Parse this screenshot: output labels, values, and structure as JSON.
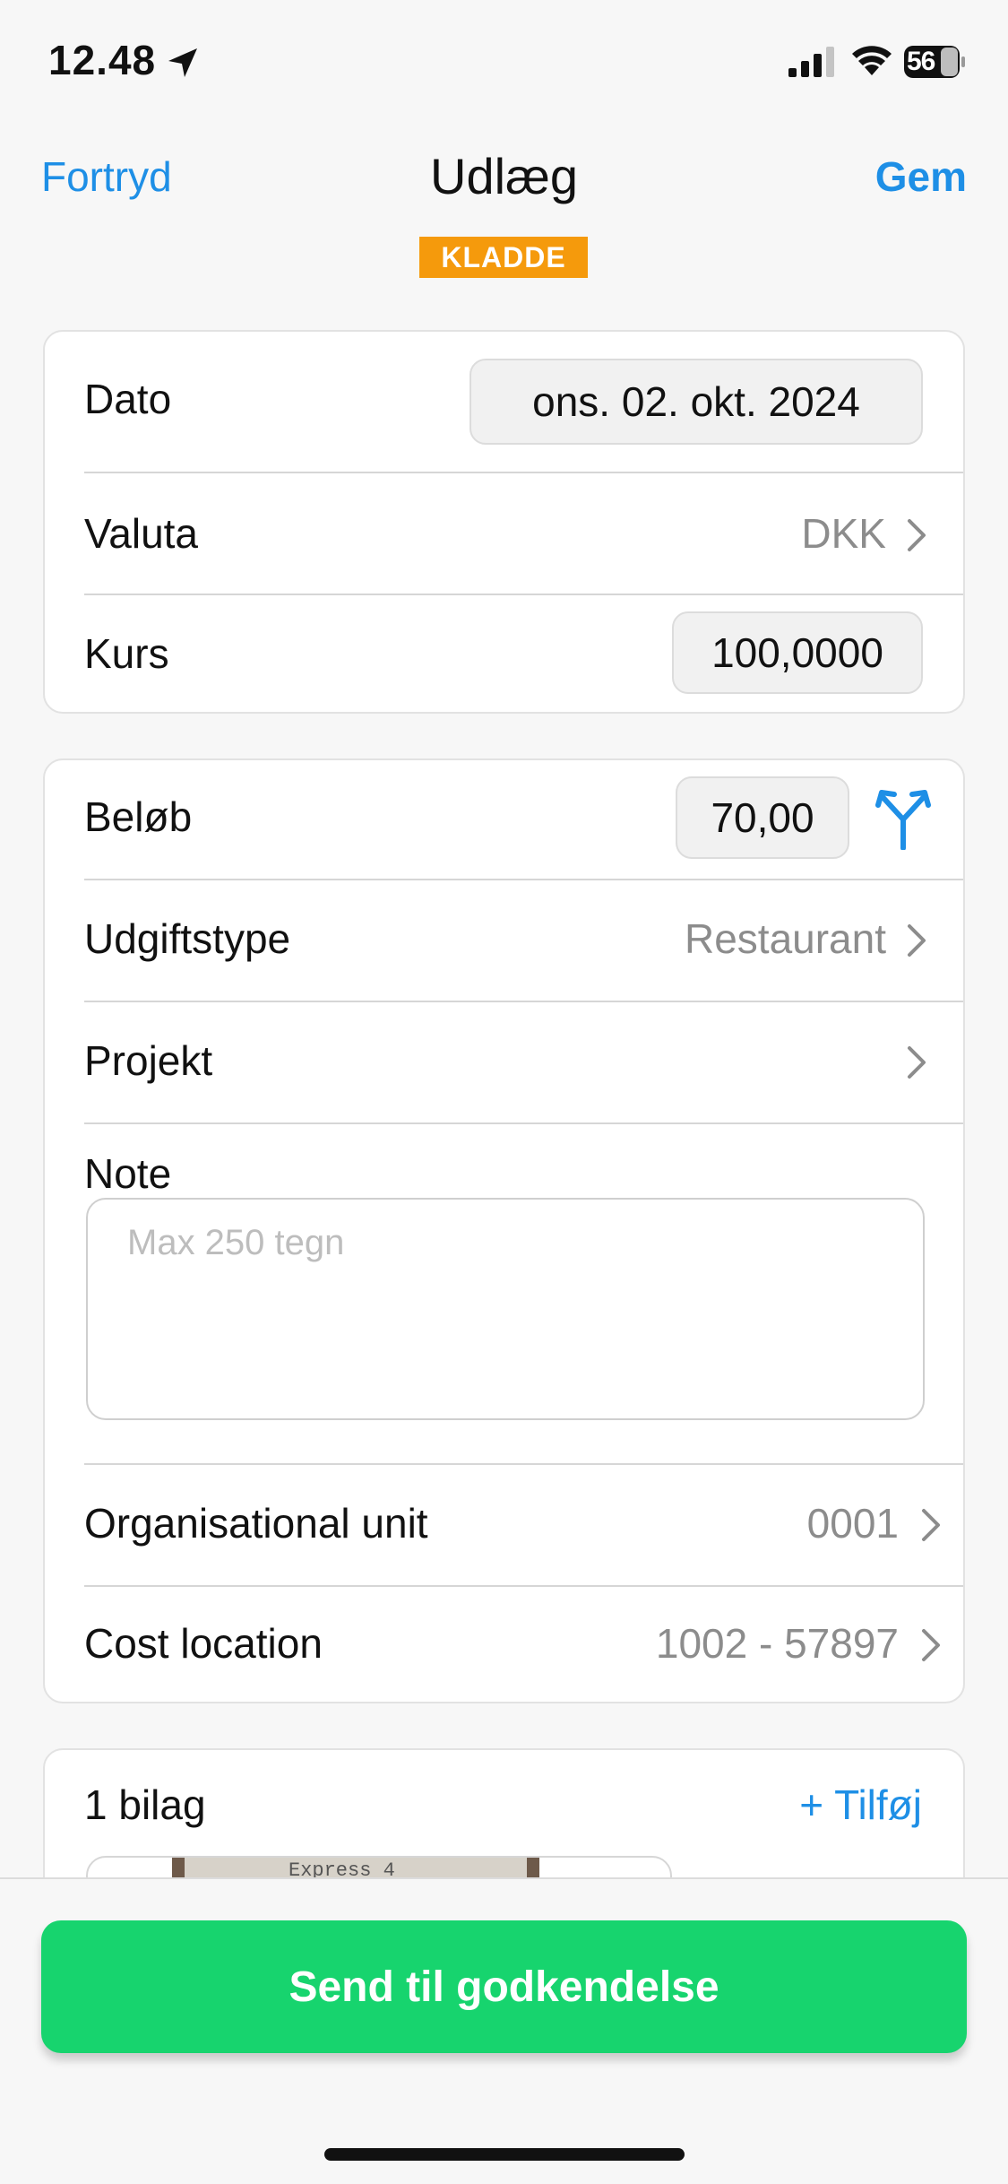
{
  "status_bar": {
    "time": "12.48",
    "battery": "56"
  },
  "nav": {
    "cancel_label": "Fortryd",
    "title": "Udlæg",
    "save_label": "Gem",
    "status_badge": "KLADDE"
  },
  "general": {
    "date_label": "Dato",
    "date_value": "ons. 02. okt. 2024",
    "currency_label": "Valuta",
    "currency_value": "DKK",
    "rate_label": "Kurs",
    "rate_value": "100,0000"
  },
  "details": {
    "amount_label": "Beløb",
    "amount_value": "70,00",
    "expense_type_label": "Udgiftstype",
    "expense_type_value": "Restaurant",
    "project_label": "Projekt",
    "project_value": "",
    "note_label": "Note",
    "note_placeholder": "Max 250 tegn",
    "org_unit_label": "Organisational unit",
    "org_unit_value": "0001",
    "cost_location_label": "Cost location",
    "cost_location_value": "1002 - 57897"
  },
  "attachments": {
    "count_label": "1 bilag",
    "add_label": "+ Tilføj",
    "receipt_text": "Express 4"
  },
  "footer": {
    "submit_label": "Send til godkendelse"
  },
  "colors": {
    "accent": "#1e8fe6",
    "submit": "#17d46e",
    "badge": "#f59a0c"
  },
  "icons": [
    "location-arrow-icon",
    "signal-icon",
    "wifi-icon",
    "battery-icon",
    "chevron-right-icon",
    "split-icon"
  ]
}
